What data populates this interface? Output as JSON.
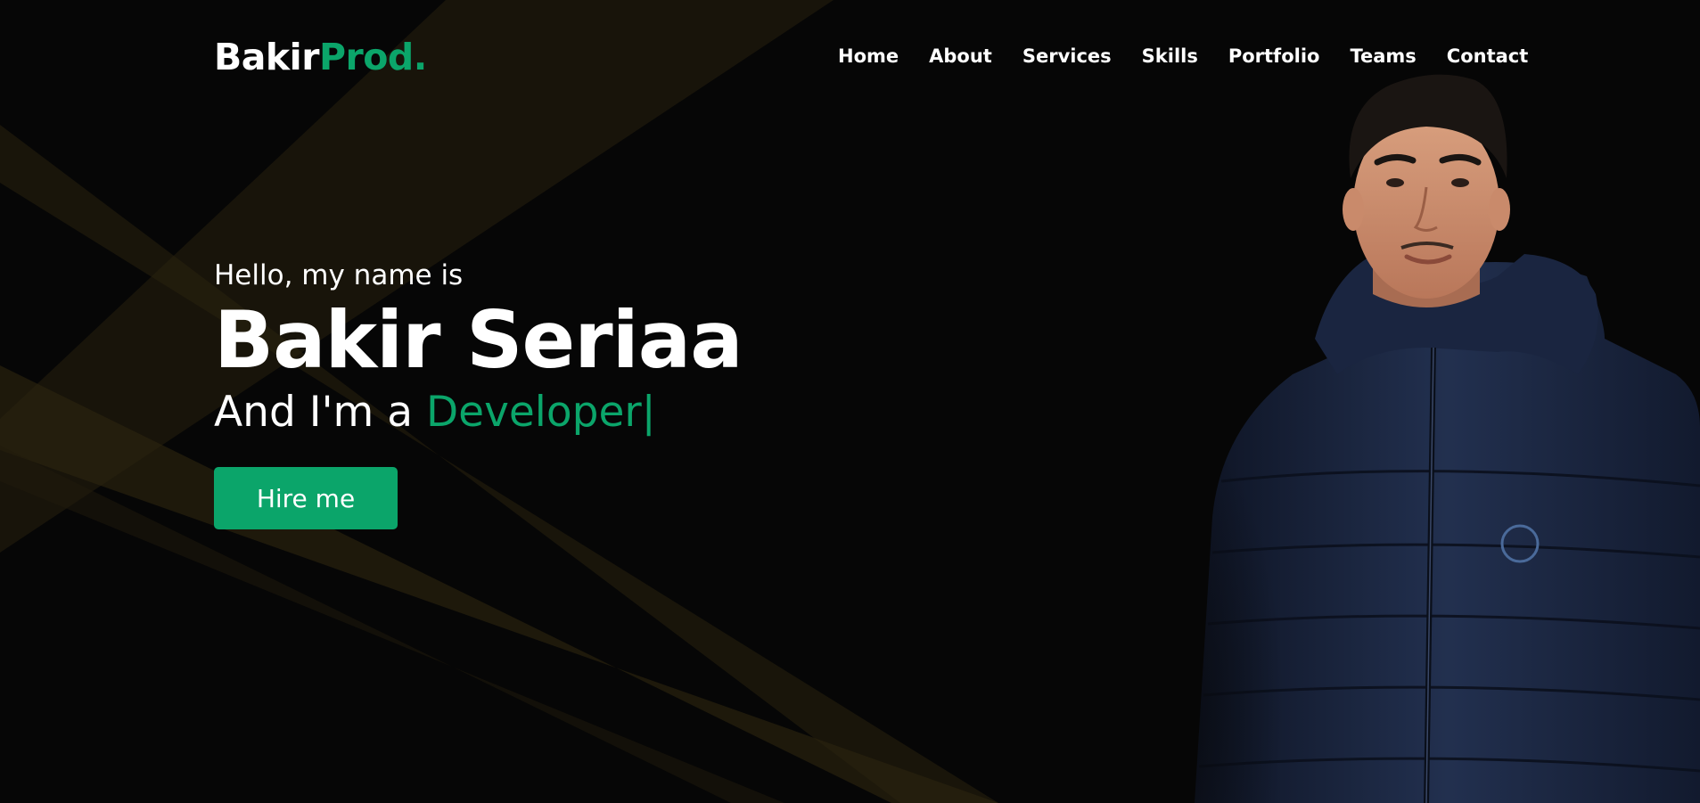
{
  "brand": {
    "part1": "Bakir",
    "part2": "Prod."
  },
  "nav": {
    "items": [
      {
        "label": "Home"
      },
      {
        "label": "About"
      },
      {
        "label": "Services"
      },
      {
        "label": "Skills"
      },
      {
        "label": "Portfolio"
      },
      {
        "label": "Teams"
      },
      {
        "label": "Contact"
      }
    ]
  },
  "hero": {
    "greeting": "Hello, my name is",
    "name": "Bakir Seriaa",
    "role_prefix": "And I'm a ",
    "role": "Developer|",
    "cta_label": "Hire me"
  },
  "colors": {
    "background": "#060606",
    "accent": "#0ba56a",
    "text": "#ffffff",
    "ray": "#2a220e",
    "jacket": "#1d2a45"
  },
  "icons": {
    "portrait": "person-portrait-image"
  }
}
